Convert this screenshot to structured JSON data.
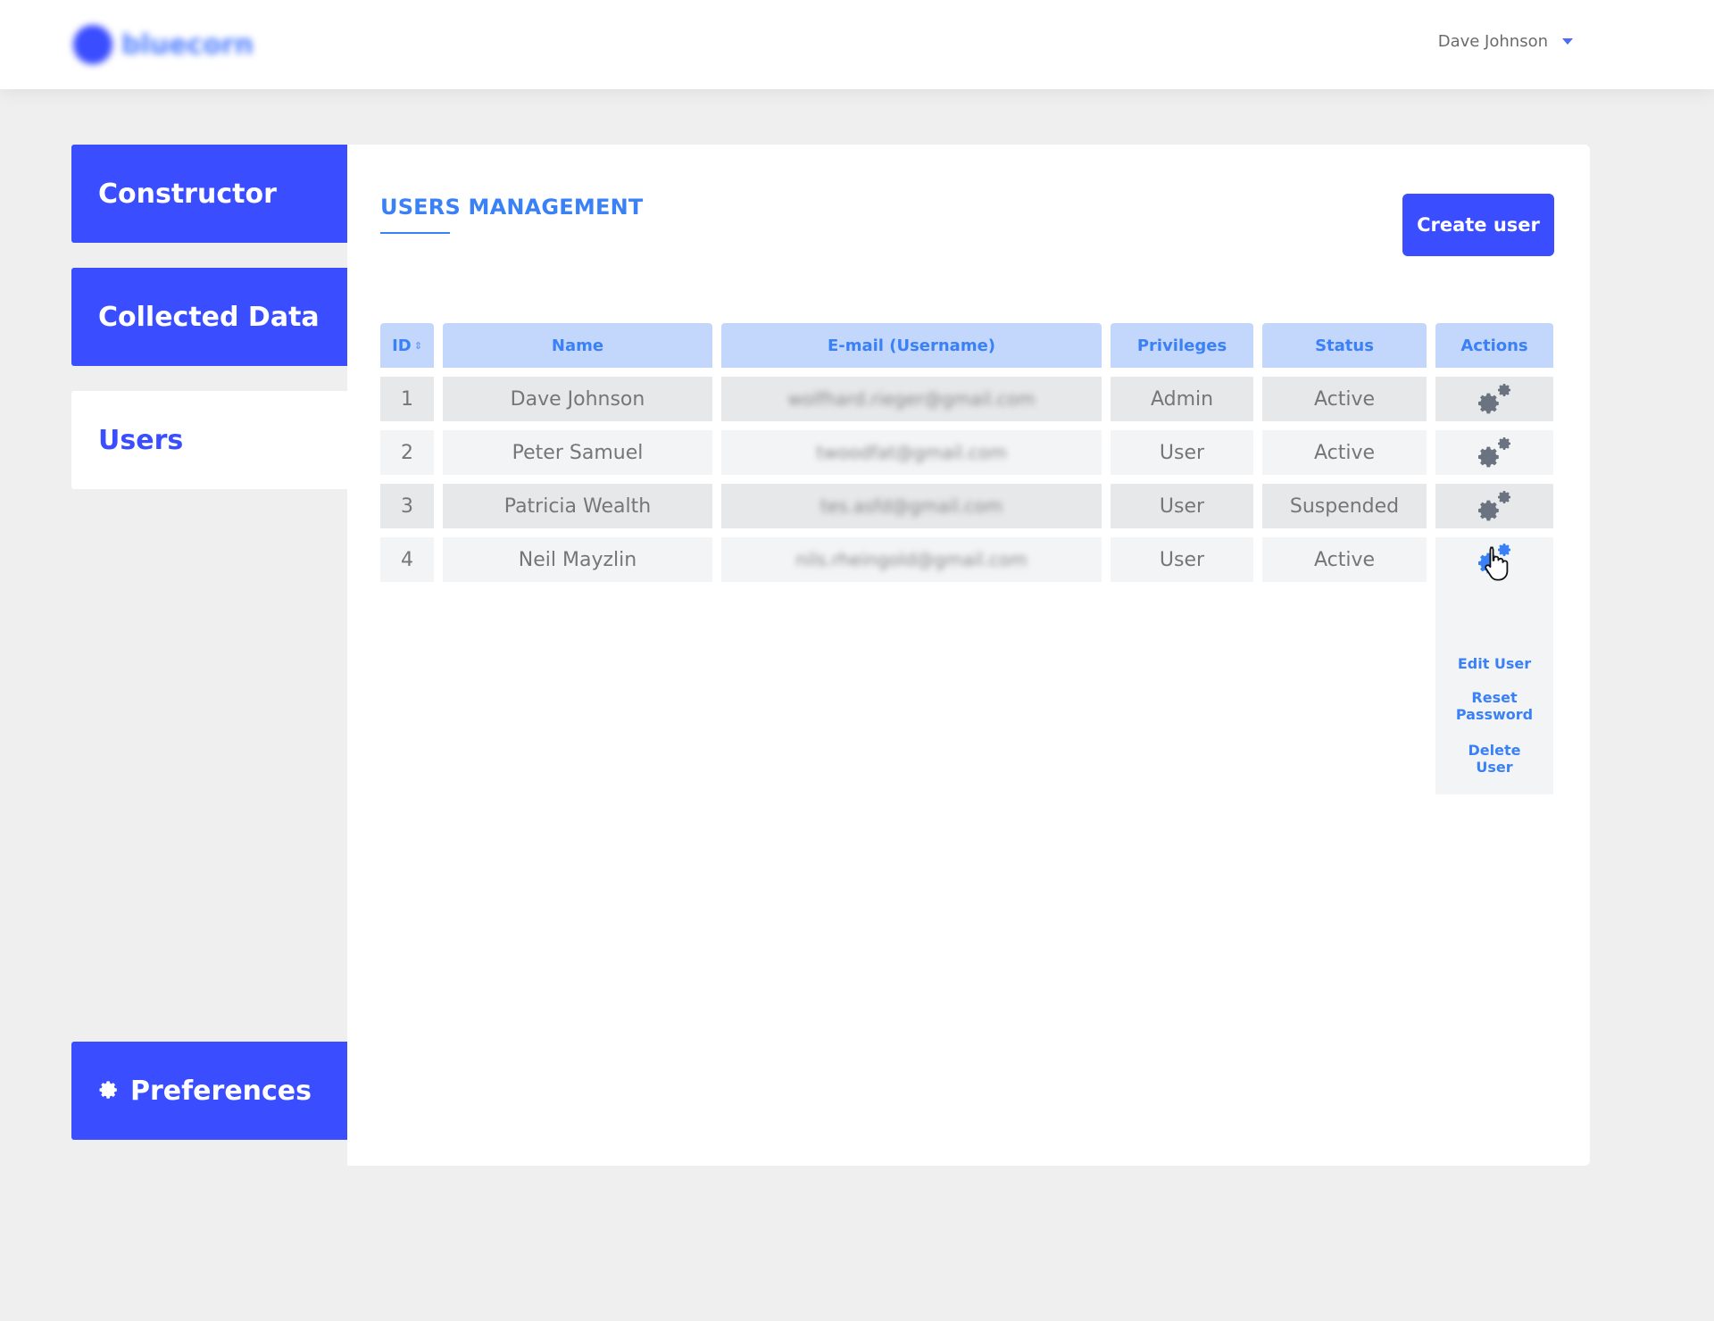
{
  "header": {
    "logo_text": "bluecorn",
    "user_name": "Dave Johnson"
  },
  "sidebar": {
    "items": [
      {
        "label": "Constructor",
        "state": "primary"
      },
      {
        "label": "Collected Data",
        "state": "primary"
      },
      {
        "label": "Users",
        "state": "active"
      }
    ],
    "preferences_label": "Preferences"
  },
  "main": {
    "title": "USERS MANAGEMENT",
    "create_button": "Create user",
    "table": {
      "columns": [
        "ID",
        "Name",
        "E-mail (Username)",
        "Privileges",
        "Status",
        "Actions"
      ],
      "rows": [
        {
          "id": "1",
          "name": "Dave Johnson",
          "email": "wolfhard.rieger@gmail.com",
          "privileges": "Admin",
          "status": "Active"
        },
        {
          "id": "2",
          "name": "Peter Samuel",
          "email": "twoodfat@gmail.com",
          "privileges": "User",
          "status": "Active"
        },
        {
          "id": "3",
          "name": "Patricia Wealth",
          "email": "tes.asfd@gmail.com",
          "privileges": "User",
          "status": "Suspended"
        },
        {
          "id": "4",
          "name": "Neil Mayzlin",
          "email": "nils.rheingold@gmail.com",
          "privileges": "User",
          "status": "Active"
        }
      ]
    },
    "actions_menu": {
      "edit": "Edit User",
      "reset_line1": "Reset",
      "reset_line2": "Password",
      "delete_line1": "Delete",
      "delete_line2": "User"
    }
  },
  "colors": {
    "brand": "#3a4dff",
    "accent": "#3a80f7",
    "header_cell": "#c3d6fb",
    "icon_gray": "#6b7280"
  }
}
